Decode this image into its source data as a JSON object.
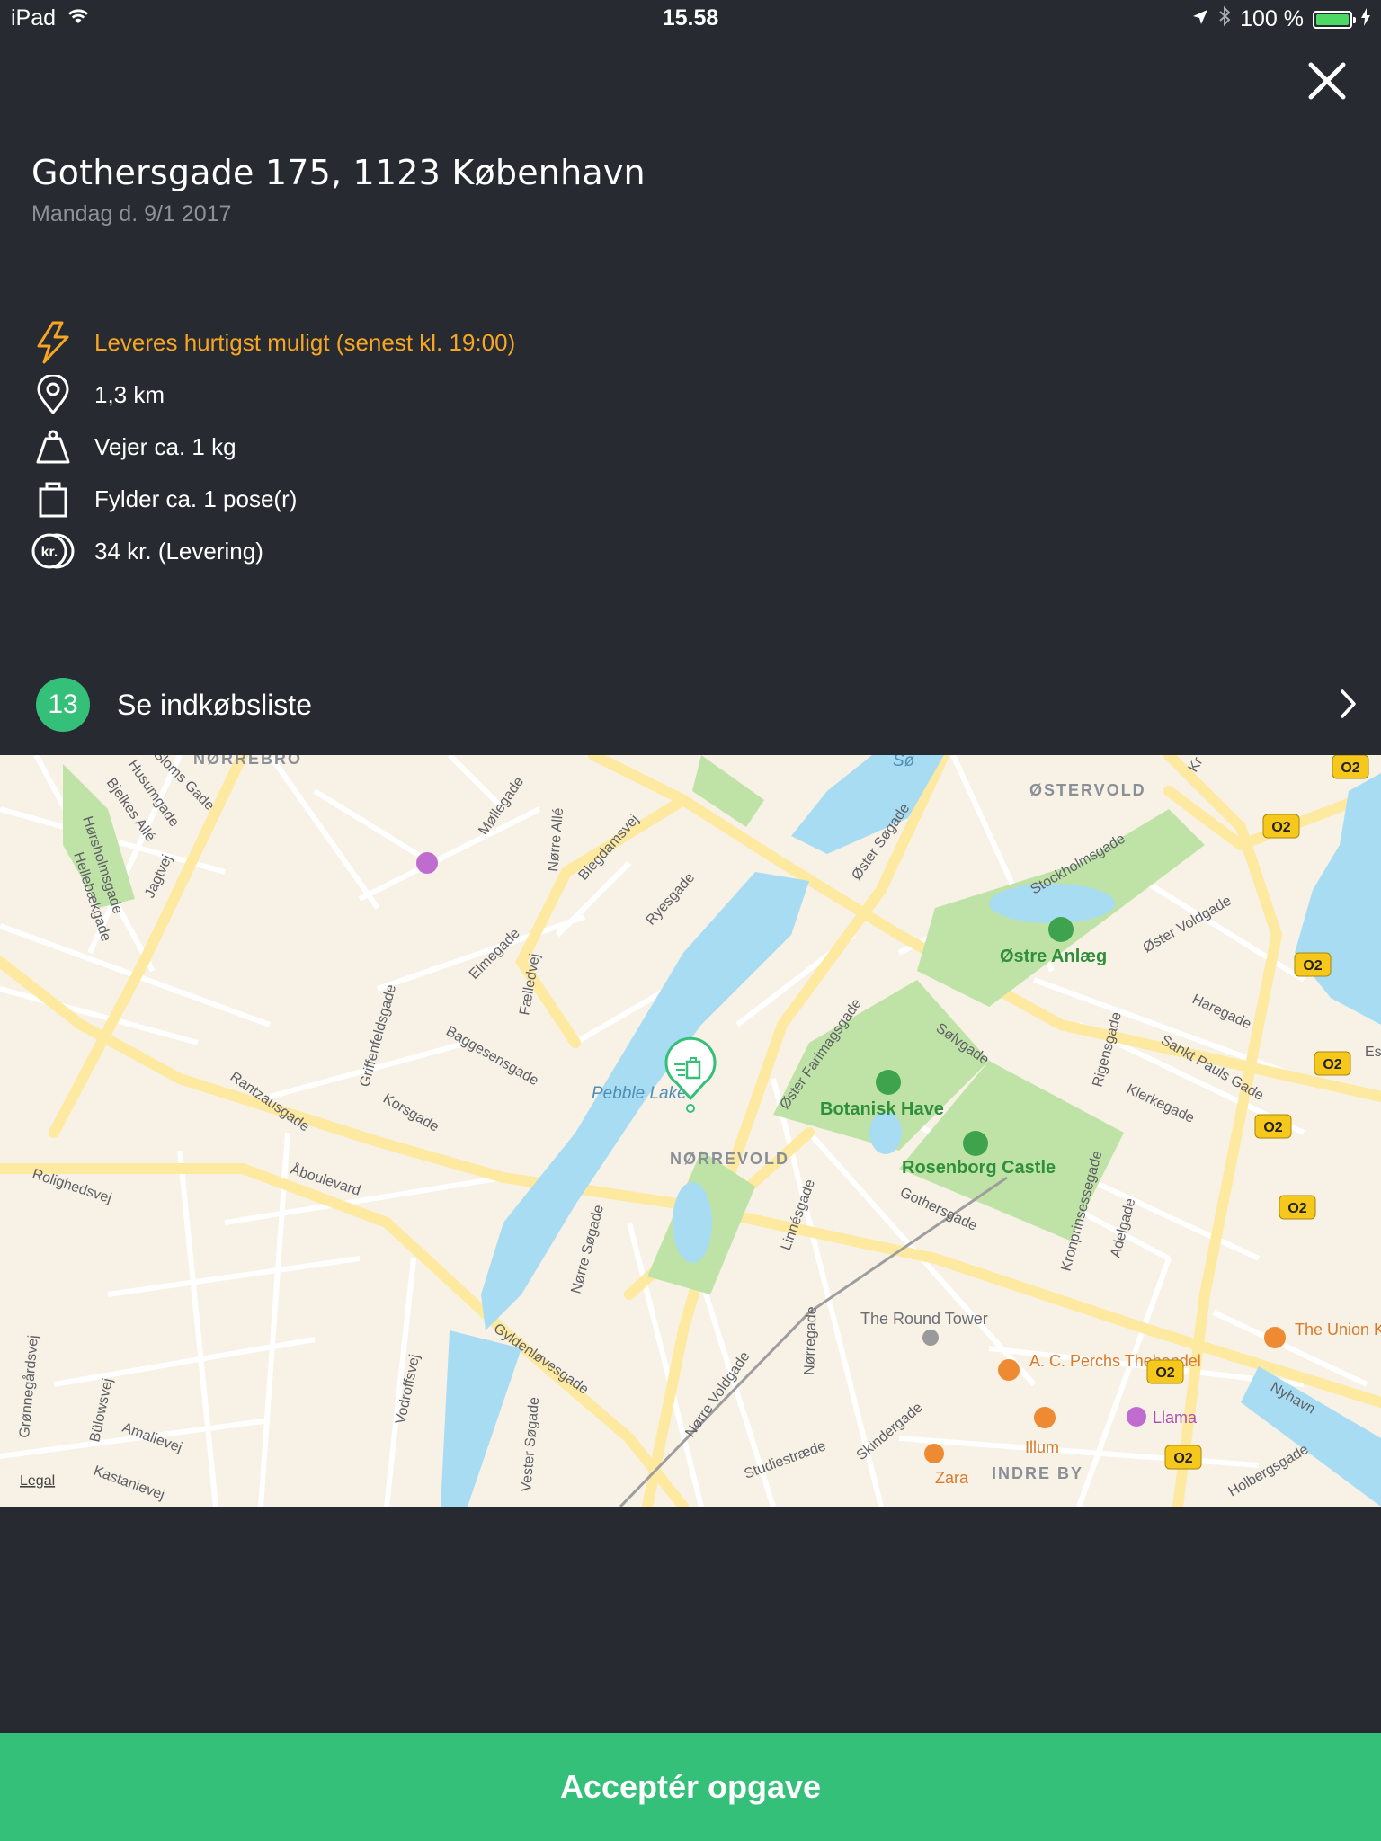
{
  "status_bar": {
    "device": "iPad",
    "time": "15.58",
    "battery": "100 %"
  },
  "order": {
    "address": "Gothersgade 175, 1123 København",
    "date": "Mandag d. 9/1 2017",
    "details": [
      {
        "icon": "lightning-icon",
        "text": "Leveres hurtigst muligt (senest kl. 19:00)"
      },
      {
        "icon": "location-pin-icon",
        "text": "1,3 km"
      },
      {
        "icon": "weight-icon",
        "text": "Vejer ca. 1 kg"
      },
      {
        "icon": "bag-icon",
        "text": "Fylder ca. 1 pose(r)"
      },
      {
        "icon": "coins-icon",
        "text": "34 kr. (Levering)"
      }
    ],
    "coin_label": "kr."
  },
  "shopping_list": {
    "count": "13",
    "label": "Se indkøbsliste"
  },
  "map": {
    "legal": "Legal",
    "areas": [
      "NØRREBRO",
      "ØSTERVOLD",
      "NØRREVOLD",
      "INDRE BY"
    ],
    "lakes": [
      "Sø",
      "Pebble Lake"
    ],
    "parks": [
      "Østre Anlæg",
      "Botanisk Have",
      "Rosenborg Castle"
    ],
    "streets": [
      "Jagtvej",
      "Hørsholmsgade",
      "Hellebækgade",
      "Bjelkes Allé",
      "Husumgade",
      "Sloms Gade",
      "Møllegade",
      "Nørre Allé",
      "Blegdamsvej",
      "Ryesgade",
      "Øster Søgade",
      "Stockholmsgade",
      "Øster Voldgade",
      "Fælledvej",
      "Elmegade",
      "Griffenfeldsgade",
      "Baggesensgade",
      "Korsgade",
      "Rantzausgade",
      "Åboulevard",
      "Rolighedsvej",
      "Nørre Søgade",
      "Gyldenløvesgade",
      "Vodroffsvej",
      "Vester Søgade",
      "Bülowsvej",
      "Amalievej",
      "Kastanievej",
      "Grønnegårdsvej",
      "Sølvgade",
      "Øster Farimagsgade",
      "Gothersgade",
      "Kronprinsessegade",
      "Adelgade",
      "Rigensgade",
      "Sankt Pauls Gade",
      "Haregade",
      "Klerkegade",
      "Linnésgade",
      "Nørregade",
      "Nørre Voldgade",
      "Studiestræde",
      "Skindergade",
      "Nyhavn",
      "Holbergsgade",
      "Es",
      "Kr"
    ],
    "pois": [
      "The Round Tower",
      "A. C. Perchs Thehandel",
      "Illum",
      "Llama",
      "Zara",
      "The Union Kitchen"
    ],
    "badge": "O2"
  },
  "actions": {
    "accept": "Acceptér opgave"
  }
}
